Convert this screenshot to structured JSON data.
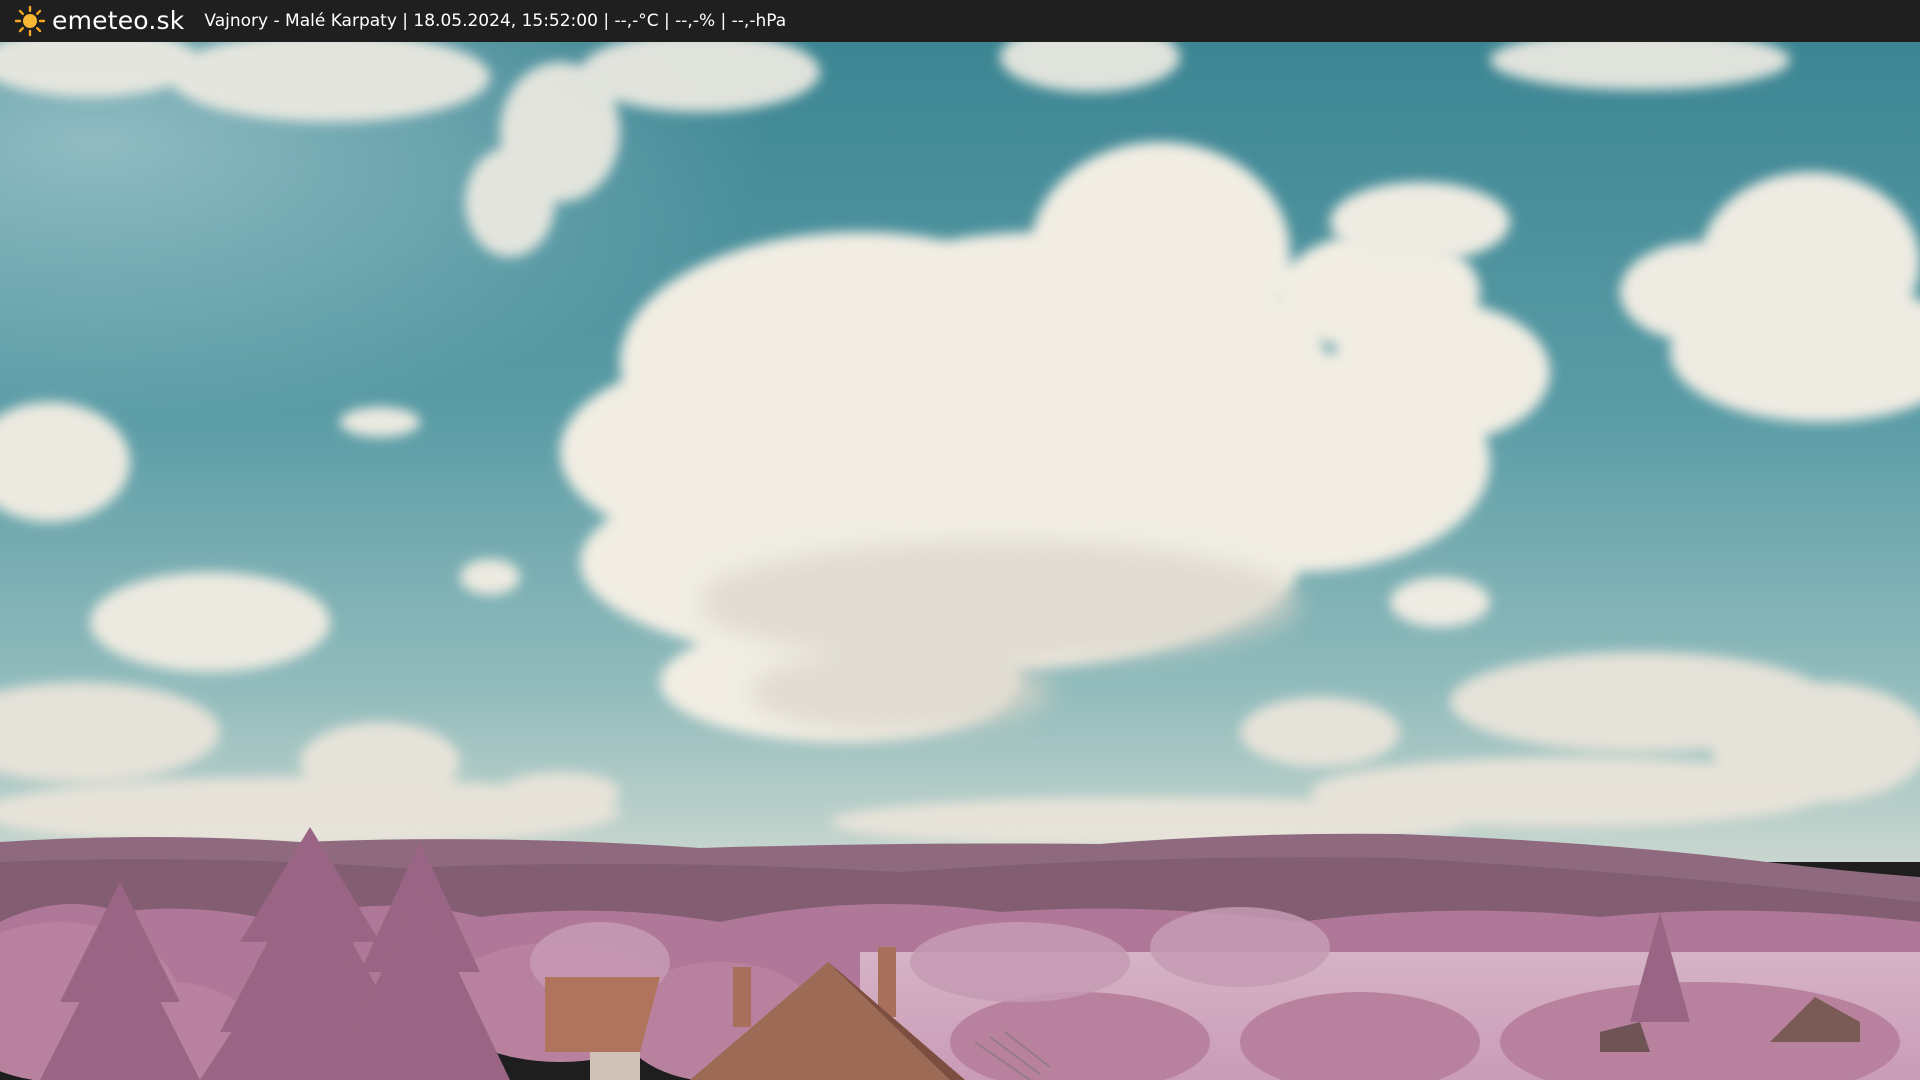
{
  "header": {
    "brand": "emeteo.sk",
    "brand_icon": "sun-icon",
    "status": "Vajnory - Malé Karpaty | 18.05.2024, 15:52:00 | --,-°C | --,-% | --,-hPa"
  },
  "scene": {
    "description_icon": "webcam-image",
    "colors": {
      "header_bg": "#1f1f1f",
      "sky_top": "#3f8896",
      "sky_bottom": "#a6c6c4",
      "cloud": "#f1ede3",
      "hills": "#8c6479",
      "foliage": "#b47a9e",
      "roof": "#a8705a"
    }
  }
}
